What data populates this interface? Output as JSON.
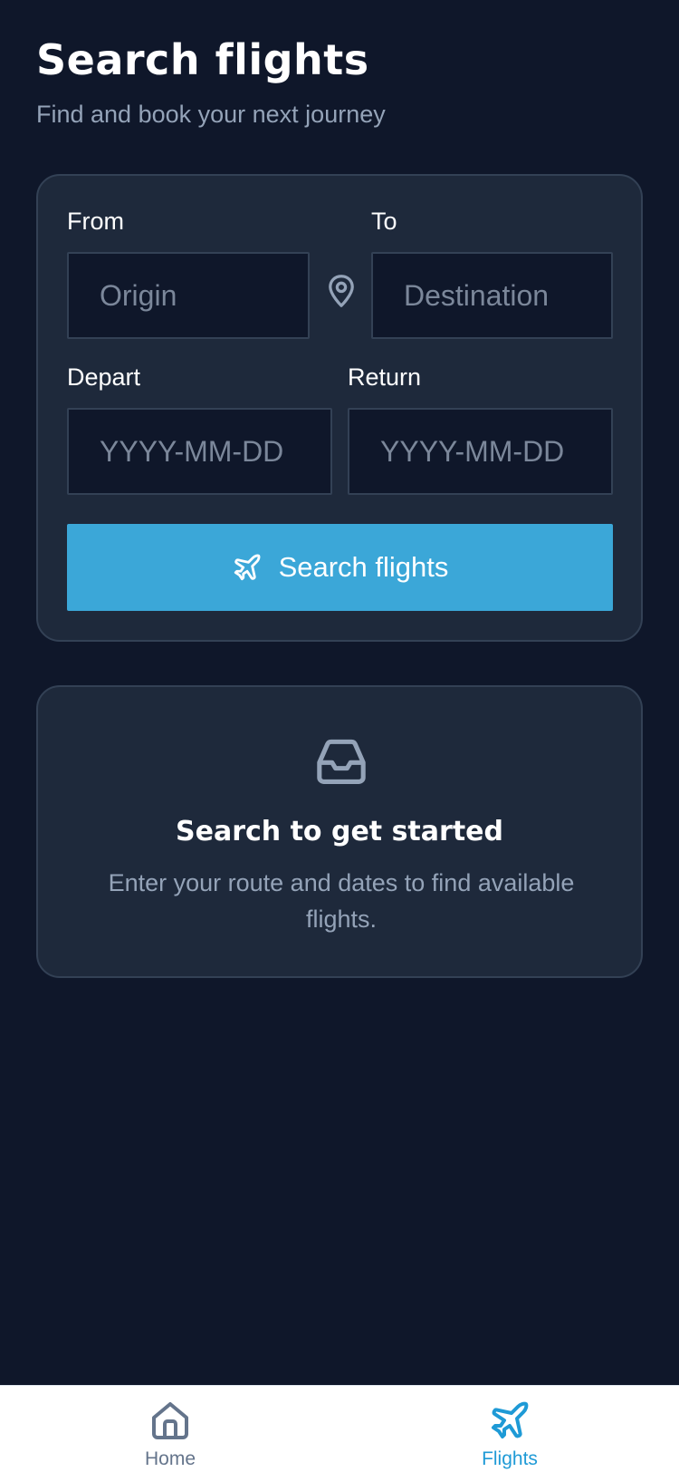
{
  "header": {
    "title": "Search flights",
    "subtitle": "Find and book your next journey"
  },
  "search_form": {
    "from_label": "From",
    "from_placeholder": "Origin",
    "to_label": "To",
    "to_placeholder": "Destination",
    "depart_label": "Depart",
    "depart_placeholder": "YYYY-MM-DD",
    "return_label": "Return",
    "return_placeholder": "YYYY-MM-DD",
    "submit_label": "Search flights",
    "swap_icon": "map-pin-icon",
    "submit_icon": "airplane-icon"
  },
  "empty_state": {
    "icon": "inbox-icon",
    "title": "Search to get started",
    "text": "Enter your route and dates to find available flights."
  },
  "tab_bar": {
    "tabs": [
      {
        "label": "Home",
        "icon": "home-icon",
        "active": false
      },
      {
        "label": "Flights",
        "icon": "airplane-icon",
        "active": true
      }
    ]
  },
  "colors": {
    "background": "#0f172a",
    "card": "#1e293b",
    "accent": "#3ba7d8",
    "active_tab": "#1e9ad6",
    "muted_text": "#94a3b8"
  }
}
